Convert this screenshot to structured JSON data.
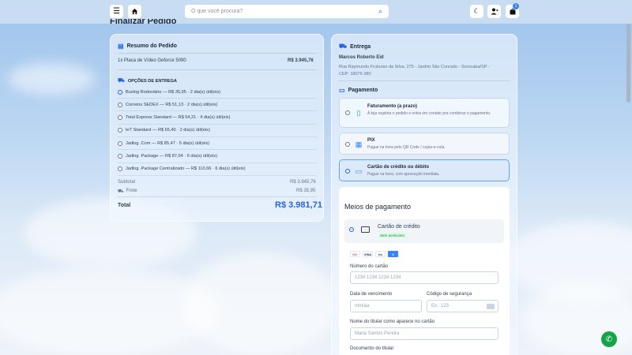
{
  "header": {
    "menu_icon": "hamburger-icon",
    "home_icon": "home-icon",
    "search_placeholder": "O que você procura?",
    "cart_count": "1"
  },
  "page_title": "Finalizar Pedido",
  "summary": {
    "title": "Resumo do Pedido",
    "item_name": "1x Placa de Vídeo Geforce 5090",
    "item_price": "R$ 3.945,76",
    "shipping_title": "OPÇÕES DE ENTREGA",
    "shipping_options": [
      {
        "label": "Buslog Rodoviário — R$ 35,95 · 2 dia(s) útil(eis)",
        "selected": true
      },
      {
        "label": "Correios SEDEX — R$ 51,13 · 2 dia(s) útil(eis)",
        "selected": false
      },
      {
        "label": "Total Express Standard — R$ 54,21 · 4 dia(s) útil(eis)",
        "selected": false
      },
      {
        "label": "IeT Standard — R$ 65,40 · 2 dia(s) útil(eis)",
        "selected": false
      },
      {
        "label": "Jadlog .Com — R$ 85,47 · 5 dia(s) útil(eis)",
        "selected": false
      },
      {
        "label": "Jadlog .Package — R$ 87,04 · 6 dia(s) útil(eis)",
        "selected": false
      },
      {
        "label": "Jadlog .Package Centralizado — R$ 110,66 · 6 dia(s) útil(eis)",
        "selected": false
      }
    ],
    "subtotal_label": "Subtotal",
    "subtotal_value": "R$ 3.945,76",
    "freight_label": "Frete",
    "freight_value": "R$ 35,95",
    "total_label": "Total",
    "total_value": "R$ 3.981,71"
  },
  "delivery": {
    "title": "Entrega",
    "name": "Marcos Roberto Eid",
    "address_line1": "Rua Raymundo Frutuoso da Silva, 275 - Jardim São Conrado - Sorocaba/SP -",
    "address_line2": "CEP: 18076-380"
  },
  "payment": {
    "title": "Pagamento",
    "options": [
      {
        "title": "Faturamento (a prazo)",
        "desc": "A loja registra o pedido e entra em contato pra combinar o pagamento.",
        "icon": "document-icon"
      },
      {
        "title": "PIX",
        "desc": "Pague na hora pelo QR Code / copia-e-cola.",
        "icon": "qr-code-icon"
      },
      {
        "title": "Cartão de crédito ou débito",
        "desc": "Pague na hora, com aprovação imediata.",
        "icon": "credit-card-icon"
      }
    ]
  },
  "card_form": {
    "title": "Meios de pagamento",
    "method_label": "Cartão de crédito",
    "method_badge": "Sem acréscimo",
    "brands": [
      "MC",
      "VISA",
      "elo",
      "$"
    ],
    "number_label": "Número do cartão",
    "number_placeholder": "1234 1234 1234 1234",
    "expiry_label": "Data de vencimento",
    "expiry_placeholder": "mm/aa",
    "cvv_label": "Código de segurança",
    "cvv_placeholder": "Ex.: 123",
    "holder_label": "Nome do titular como aparece no cartão",
    "holder_placeholder": "Maria Santos Pereira",
    "doc_label": "Documento do titular"
  },
  "colors": {
    "accent": "#2563eb",
    "whatsapp": "#16a34a"
  }
}
